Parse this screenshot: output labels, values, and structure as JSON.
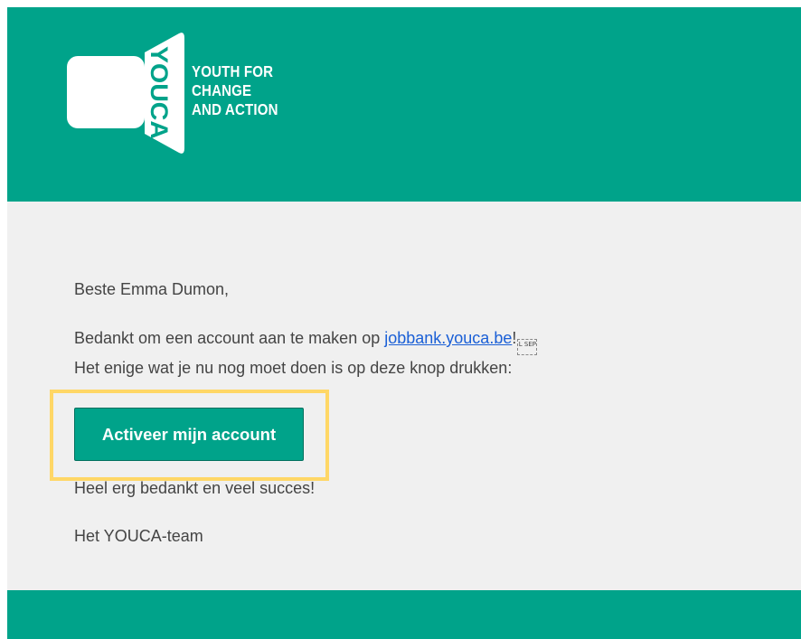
{
  "colors": {
    "brand": "#00a38a",
    "body_background": "#f0f0f0",
    "text": "#444444",
    "link": "#1a5fd6",
    "highlight": "#ffd766"
  },
  "header": {
    "logo": {
      "icon": "youca-megaphone-logo",
      "wordmark": "YOUCA",
      "tagline": [
        "YOUTH FOR",
        "CHANGE",
        "AND ACTION"
      ]
    }
  },
  "body": {
    "greeting": "Beste Emma Dumon,",
    "thanks_prefix": "Bedankt om een account aan te maken op ",
    "link_text": "jobbank.youca.be",
    "thanks_suffix": "!",
    "separator_glyph": "L SEP",
    "instruction": "Het enige wat je nu nog moet doen is op deze knop drukken:",
    "button_label": "Activeer mijn account",
    "closing": "Heel erg bedankt en veel succes!",
    "signoff": "Het YOUCA-team"
  }
}
